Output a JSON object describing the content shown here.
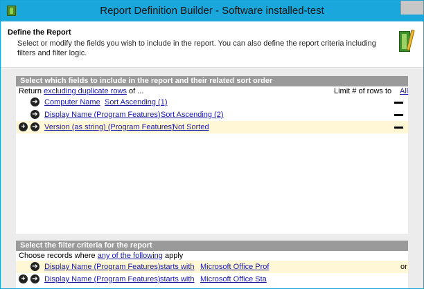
{
  "window": {
    "title": "Report Definition Builder - Software installed-test"
  },
  "header": {
    "title": "Define the Report",
    "description": "Select or modify the fields you wish to include in the report. You can also define the report criteria including filters and filter logic."
  },
  "fields_section": {
    "title": "Select which fields to include in the report and their related sort order",
    "return_prefix": "Return",
    "return_link": "excluding duplicate rows",
    "return_suffix": "of ...",
    "limit_label": "Limit # of rows to",
    "limit_value": "All",
    "rows": [
      {
        "field": "Computer Name",
        "sort": "Sort Ascending (1)"
      },
      {
        "field": "Display Name (Program Features)",
        "sort": "Sort Ascending (2)"
      },
      {
        "field": "Version (as string) (Program Features)",
        "sort": "Not Sorted"
      }
    ]
  },
  "filter_section": {
    "title": "Select the filter criteria for the report",
    "choose_prefix": "Choose records where",
    "choose_link": "any of the following",
    "choose_suffix": "apply",
    "rows": [
      {
        "field": "Display Name (Program Features)",
        "operator": "starts with",
        "value": "Microsoft Office Prof",
        "logic": "or"
      },
      {
        "field": "Display Name (Program Features)",
        "operator": "starts with",
        "value": "Microsoft Office Sta",
        "logic": ""
      }
    ]
  }
}
